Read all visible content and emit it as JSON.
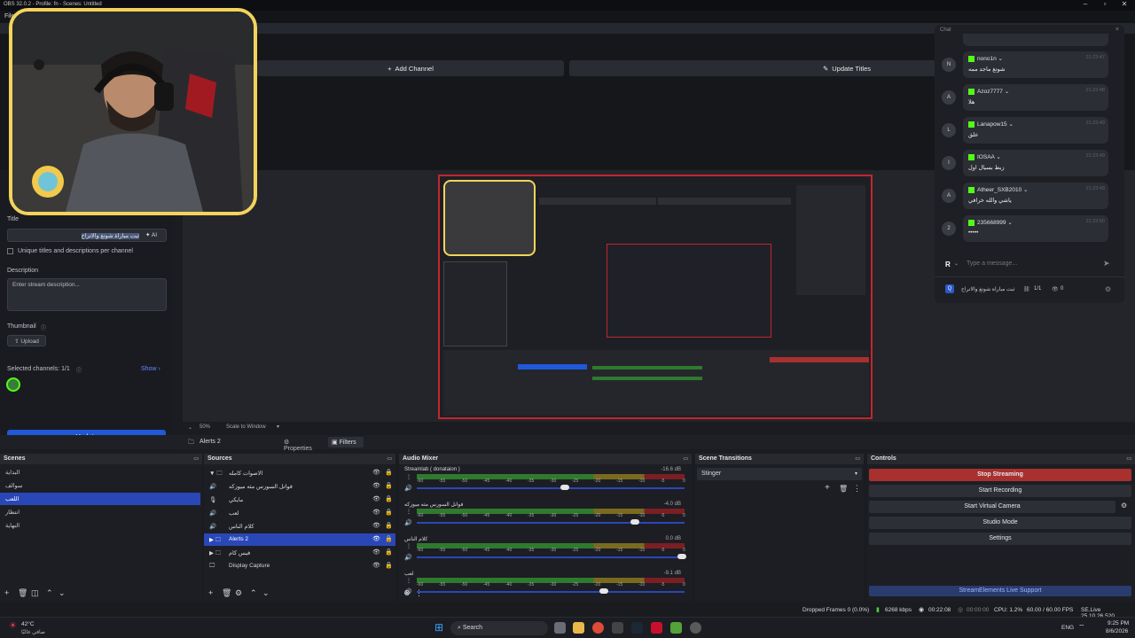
{
  "window": {
    "title": "OBS 32.0.2 - Profile: fn - Scenes: Untitled"
  },
  "menu": {
    "file": "File"
  },
  "top_dock": {
    "add_channel": "Add Channel",
    "update_titles": "Update Titles"
  },
  "stream_panel": {
    "title_label": "Title",
    "title_value": "ثبت مباراة شوتغ والاتراح",
    "ai_label": "AI",
    "unique_label": "Unique titles and descriptions per channel",
    "description_label": "Description",
    "description_placeholder": "Enter stream description...",
    "thumbnail_label": "Thumbnail",
    "upload_label": "Upload",
    "selected_channels_label": "Selected channels: 1/1",
    "show_label": "Show",
    "update_label": "Update"
  },
  "chat": {
    "header": "Chat",
    "messages": [
      {
        "avatar": "N",
        "user": "nono1n",
        "text": "شوتغ ماجد ممه",
        "time": "21:23:47"
      },
      {
        "avatar": "A",
        "user": "Azoz7777",
        "text": "هلا",
        "time": "21:23:48"
      },
      {
        "avatar": "L",
        "user": "Lanapow15",
        "text": "علق",
        "time": "21:23:49"
      },
      {
        "avatar": "I",
        "user": "IOSAA",
        "text": "زبط بسيال اول",
        "time": "21:23:49"
      },
      {
        "avatar": "A",
        "user": "Atheer_SXB2010",
        "text": "ياشي والله خرافي",
        "time": "21:23:49"
      },
      {
        "avatar": "2",
        "user": "235668999",
        "text": "•••••",
        "time": "21:23:50"
      }
    ],
    "input_placeholder": "Type a message...",
    "footer_title": "ثبت مباراة شوتغ والاتراح",
    "footer_count": "1/1",
    "footer_viewers": "0"
  },
  "preview": {
    "zoom": "50%",
    "scale_mode": "Scale to Window"
  },
  "source_bar": {
    "selected": "Alerts 2",
    "properties": "Properties",
    "filters": "Filters"
  },
  "scenes": {
    "header": "Scenes",
    "items": [
      "البداية",
      "سوالف",
      "اللعب",
      "انتظار",
      "النهاية"
    ],
    "selected_index": 2
  },
  "sources": {
    "header": "Sources",
    "items": [
      "الاصوات كامله",
      "فواتل السورس مثه ميوزكه",
      "مايكي",
      "لعب",
      "كلام الناس",
      "Alerts 2",
      "فيس كام",
      "Display Capture"
    ],
    "selected_index": 5
  },
  "mixer": {
    "header": "Audio Mixer",
    "tracks": [
      {
        "name": "Streamlab ( donataion )",
        "db": "-16.6 dB",
        "level": 0.55
      },
      {
        "name": "فواتل السورس مثه ميوزكه",
        "db": "-4.0 dB",
        "level": 0.82
      },
      {
        "name": "كلام الناس",
        "db": "0.0 dB",
        "level": 1.0
      },
      {
        "name": "لعب",
        "db": "-9.1 dB",
        "level": 0.7
      }
    ],
    "scale": [
      "-60",
      "-55",
      "-50",
      "-45",
      "-40",
      "-35",
      "-30",
      "-25",
      "-20",
      "-15",
      "-10",
      "-5",
      "0"
    ]
  },
  "transitions": {
    "header": "Scene Transitions",
    "selected": "Stinger"
  },
  "controls": {
    "header": "Controls",
    "stop_streaming": "Stop Streaming",
    "start_recording": "Start Recording",
    "start_virtual_camera": "Start Virtual Camera",
    "studio_mode": "Studio Mode",
    "settings": "Settings",
    "support": "StreamElements Live Support"
  },
  "status": {
    "dropped": "Dropped Frames 0 (0.0%)",
    "bitrate": "6268 kbps",
    "stream_time": "00:22:08",
    "rec_time": "00:00:00",
    "cpu": "CPU: 1.2%",
    "fps": "60.00 / 60.00 FPS",
    "version": "SE.Live 25.10.26.520"
  },
  "taskbar": {
    "weather_temp": "42°C",
    "weather_desc": "صافي غالبًا",
    "search": "Search",
    "lang": "ENG",
    "time": "9:25 PM",
    "date": "8/6/2026"
  },
  "colors": {
    "accent_blue": "#2058d8",
    "stop_red": "#c0392b",
    "kick_green": "#53fc18",
    "webcam_border": "#f2d45c"
  }
}
